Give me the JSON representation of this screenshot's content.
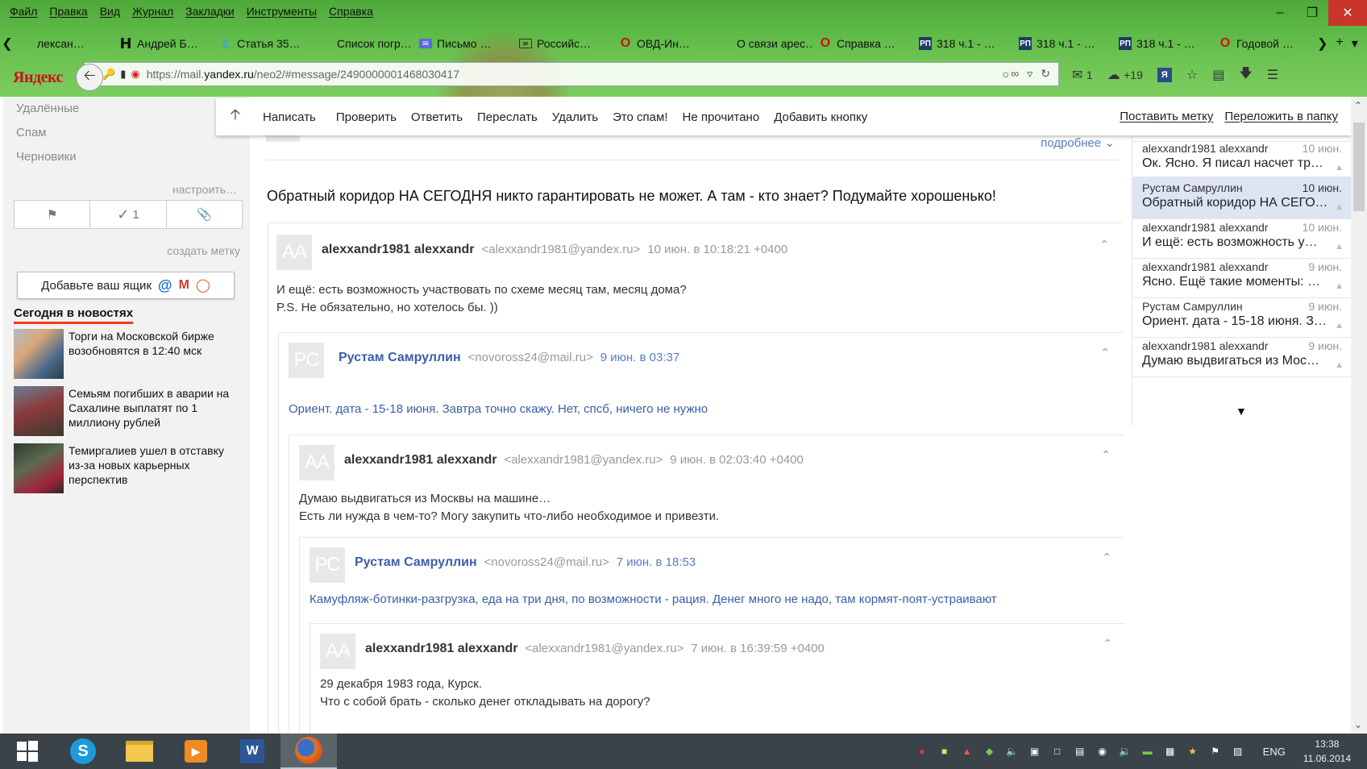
{
  "browser": {
    "menu": [
      "Файл",
      "Правка",
      "Вид",
      "Журнал",
      "Закладки",
      "Инструменты",
      "Справка"
    ],
    "tabs": [
      {
        "icon": "",
        "label": "лексан…"
      },
      {
        "icon": "h",
        "label": "Андрей Б…"
      },
      {
        "icon": "z",
        "label": "Статья 35…"
      },
      {
        "icon": "",
        "label": "Список погр…"
      },
      {
        "icon": "env",
        "label": "Письмо …"
      },
      {
        "icon": "mail",
        "label": "Российс…"
      },
      {
        "icon": "o",
        "label": "ОВД-Ин…"
      },
      {
        "icon": "",
        "label": "О связи арес…"
      },
      {
        "icon": "o",
        "label": "Справка …"
      },
      {
        "icon": "rp",
        "label": "318 ч.1 - …"
      },
      {
        "icon": "rp",
        "label": "318 ч.1 - …"
      },
      {
        "icon": "rp",
        "label": "318 ч.1 - …"
      },
      {
        "icon": "o",
        "label": "Годовой …"
      }
    ],
    "logo": "Яндекс",
    "url_prefix": "https://mail.",
    "url_domain": "yandex.ru",
    "url_rest": "/neo2/#message/2490000001468030417",
    "mail_count": "1",
    "weather": "+19"
  },
  "toolbar": {
    "actions": [
      "Написать",
      "Проверить",
      "Ответить",
      "Переслать",
      "Удалить",
      "Это спам!",
      "Не прочитано",
      "Добавить кнопку"
    ],
    "set_label": "Поставить метку",
    "move_label": "Переложить в папку"
  },
  "sidebar": {
    "folders": [
      "Удалённые",
      "Спам",
      "Черновики"
    ],
    "customize": "настроить…",
    "filter_check_count": "1",
    "create_label": "создать метку",
    "add_box": "Добавьте ваш ящик",
    "news_title": "Сегодня в новостях",
    "news": [
      {
        "text": "Торги на Московской бирже возобновятся в 12:40 мск"
      },
      {
        "text": "Семьям погибших в аварии на Сахалине выплатят по 1 миллиону рублей"
      },
      {
        "text": "Темиргалиев ушел в отставку из-за новых карьерных перспектив"
      }
    ]
  },
  "main": {
    "more_link": "подробнее",
    "subject": "Обратный коридор НА СЕГОДНЯ никто гарантировать не может. А там - кто знает? Подумайте хорошенько!",
    "messages": [
      {
        "initials": "AA",
        "name": "alexxandr1981 alexxandr",
        "email": "<alexxandr1981@yandex.ru>",
        "date": "10 июн. в 10:18:21 +0400",
        "lines": [
          "И ещё: есть возможность участвовать по схеме месяц там, месяц дома?",
          "P.S. Не обязательно, но хотелось бы. ))"
        ]
      },
      {
        "initials": "РС",
        "name": "Рустам Самруллин",
        "email": "<novoross24@mail.ru>",
        "date": "9 июн. в 03:37",
        "lines": [
          "Ориент. дата - 15-18 июня. Завтра точно скажу. Нет, спсб, ничего не нужно"
        ]
      },
      {
        "initials": "AA",
        "name": "alexxandr1981 alexxandr",
        "email": "<alexxandr1981@yandex.ru>",
        "date": "9 июн. в 02:03:40 +0400",
        "lines": [
          "Думаю выдвигаться из Москвы на машине…",
          "Есть ли нужда в чем-то? Могу закупить что-либо необходимое и привезти."
        ]
      },
      {
        "initials": "РС",
        "name": "Рустам Самруллин",
        "email": "<novoross24@mail.ru>",
        "date": "7 июн. в 18:53",
        "lines": [
          "Камуфляж-ботинки-разгрузка, еда на три дня, по возможности - рация. Денег много не надо, там кормят-поят-устраивают"
        ]
      },
      {
        "initials": "AA",
        "name": "alexxandr1981 alexxandr",
        "email": "<alexxandr1981@yandex.ru>",
        "date": "7 июн. в 16:39:59 +0400",
        "lines": [
          "29 декабря 1983 года, Курск.",
          "Что с собой брать - сколько денег откладывать на дорогу?"
        ]
      }
    ]
  },
  "thread": [
    {
      "from": "alexxandr1981 alexxandr",
      "date": "10 июн.",
      "snippet": "Ок. Ясно. Я писал насчет тр…",
      "active": false
    },
    {
      "from": "Рустам Самруллин",
      "date": "10 июн.",
      "snippet": "Обратный коридор НА СЕГОД…",
      "active": true
    },
    {
      "from": "alexxandr1981 alexxandr",
      "date": "10 июн.",
      "snippet": "И ещё: есть возможность у…",
      "active": false
    },
    {
      "from": "alexxandr1981 alexxandr",
      "date": "9 июн.",
      "snippet": "Ясно. Ещё такие моменты: …",
      "active": false
    },
    {
      "from": "Рустам Самруллин",
      "date": "9 июн.",
      "snippet": "Ориент. дата - 15-18 июня. Зав…",
      "active": false
    },
    {
      "from": "alexxandr1981 alexxandr",
      "date": "9 июн.",
      "snippet": "Думаю выдвигаться из Мос…",
      "active": false
    }
  ],
  "taskbar": {
    "lang": "ENG",
    "time": "13:38",
    "date": "11.06.2014"
  }
}
